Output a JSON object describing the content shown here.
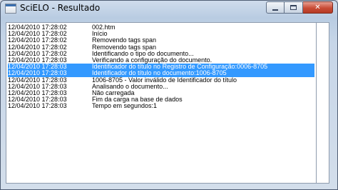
{
  "window": {
    "title": "SciELO - Resultado",
    "minimize_glyph": "minimize-icon",
    "maximize_glyph": "maximize-icon",
    "close_glyph": "✕"
  },
  "log": {
    "entries": [
      {
        "time": "12/04/2010 17:28:02",
        "message": "002.htm",
        "selected": false
      },
      {
        "time": "12/04/2010 17:28:02",
        "message": "Início",
        "selected": false
      },
      {
        "time": "12/04/2010 17:28:02",
        "message": "Removendo tags span",
        "selected": false
      },
      {
        "time": "12/04/2010 17:28:02",
        "message": "Removendo tags span",
        "selected": false
      },
      {
        "time": "12/04/2010 17:28:02",
        "message": "Identificando o tipo do documento...",
        "selected": false
      },
      {
        "time": "12/04/2010 17:28:03",
        "message": "Verificando a configuração do documento.",
        "selected": false
      },
      {
        "time": "12/04/2010 17:28:03",
        "message": "Identificador do título no Registro de Configuração:0006-8705",
        "selected": true
      },
      {
        "time": "12/04/2010 17:28:03",
        "message": "Identificador do título no documento:1006-8705",
        "selected": true
      },
      {
        "time": "12/04/2010 17:28:03",
        "message": "1006-8705 - Valor inválido de Identificador do título",
        "selected": false
      },
      {
        "time": "12/04/2010 17:28:03",
        "message": "Analisando o documento...",
        "selected": false
      },
      {
        "time": "12/04/2010 17:28:03",
        "message": "Não carregada",
        "selected": false
      },
      {
        "time": "12/04/2010 17:28:03",
        "message": "Fim da carga na base de dados",
        "selected": false
      },
      {
        "time": "12/04/2010 17:28:03",
        "message": "Tempo em segundos:1",
        "selected": false
      }
    ]
  }
}
